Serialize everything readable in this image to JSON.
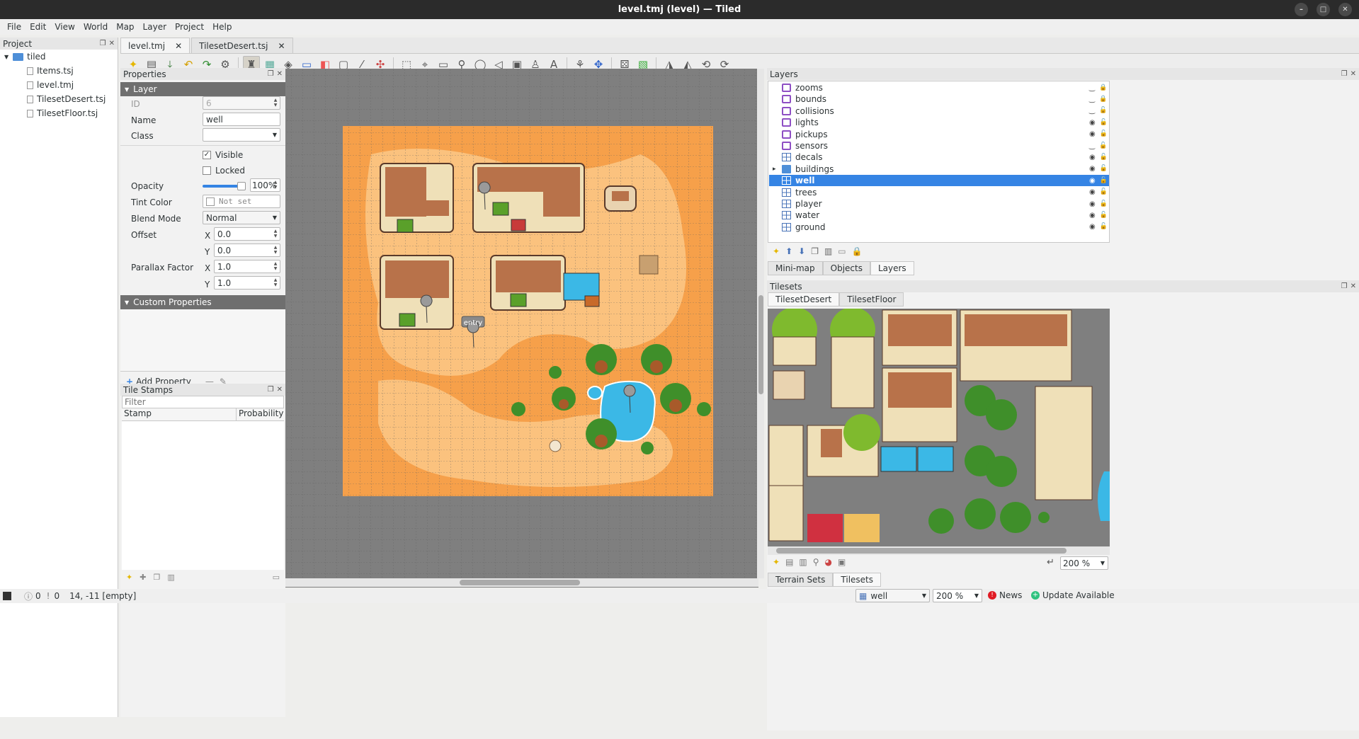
{
  "window": {
    "title": "level.tmj (level) — Tiled"
  },
  "menu": [
    "File",
    "Edit",
    "View",
    "World",
    "Map",
    "Layer",
    "Project",
    "Help"
  ],
  "project": {
    "title": "Project",
    "root": "tiled",
    "files": [
      "Items.tsj",
      "level.tmj",
      "TilesetDesert.tsj",
      "TilesetFloor.tsj"
    ]
  },
  "tabs": [
    {
      "label": "level.tmj",
      "active": true
    },
    {
      "label": "TilesetDesert.tsj",
      "active": false
    }
  ],
  "properties": {
    "title": "Properties",
    "section": "Layer",
    "id_label": "ID",
    "id_value": "6",
    "name_label": "Name",
    "name_value": "well",
    "class_label": "Class",
    "class_value": "",
    "visible_label": "Visible",
    "visible": true,
    "locked_label": "Locked",
    "locked": false,
    "opacity_label": "Opacity",
    "opacity_value": "100%",
    "opacity_level": 1.0,
    "tint_label": "Tint Color",
    "tint_value": "Not set",
    "blend_label": "Blend Mode",
    "blend_value": "Normal",
    "offset_label": "Offset",
    "offset_x": "0.0",
    "offset_y": "0.0",
    "parallax_label": "Parallax Factor",
    "parallax_x": "1.0",
    "parallax_y": "1.0",
    "x_label": "X",
    "y_label": "Y",
    "custom_section": "Custom Properties",
    "add_property": "Add Property"
  },
  "stamps": {
    "title": "Tile Stamps",
    "filter_placeholder": "Filter",
    "col_stamp": "Stamp",
    "col_probability": "Probability"
  },
  "map": {
    "entry_label": "entry"
  },
  "layers": {
    "title": "Layers",
    "items": [
      {
        "name": "zooms",
        "type": "object",
        "visible": false,
        "locked": true
      },
      {
        "name": "bounds",
        "type": "object",
        "visible": false,
        "locked": true
      },
      {
        "name": "collisions",
        "type": "object",
        "visible": false,
        "locked": false
      },
      {
        "name": "lights",
        "type": "object",
        "visible": true,
        "locked": false
      },
      {
        "name": "pickups",
        "type": "object",
        "visible": true,
        "locked": false
      },
      {
        "name": "sensors",
        "type": "object",
        "visible": false,
        "locked": false
      },
      {
        "name": "decals",
        "type": "tile",
        "visible": true,
        "locked": false
      },
      {
        "name": "buildings",
        "type": "group",
        "visible": true,
        "locked": false
      },
      {
        "name": "well",
        "type": "tile",
        "visible": true,
        "locked": false,
        "selected": true
      },
      {
        "name": "trees",
        "type": "tile",
        "visible": true,
        "locked": false
      },
      {
        "name": "player",
        "type": "tile",
        "visible": true,
        "locked": false
      },
      {
        "name": "water",
        "type": "tile",
        "visible": true,
        "locked": false
      },
      {
        "name": "ground",
        "type": "tile",
        "visible": true,
        "locked": false
      }
    ],
    "bottom_tabs": [
      "Mini-map",
      "Objects",
      "Layers"
    ]
  },
  "tilesets": {
    "title": "Tilesets",
    "tabs": [
      "TilesetDesert",
      "TilesetFloor"
    ],
    "zoom": "200 %",
    "bottom_tabs": [
      "Terrain Sets",
      "Tilesets"
    ]
  },
  "status": {
    "warnings": "0",
    "errors": "0",
    "coords": "14, -11 [empty]",
    "current_layer": "well",
    "zoom": "200 %",
    "news": "News",
    "update": "Update Available"
  },
  "colors": {
    "selection": "#3584e4",
    "sand_dark": "#f6a04a",
    "sand_light": "#fbc27e",
    "water": "#3bb8e6",
    "void": "#7f7f7f"
  }
}
